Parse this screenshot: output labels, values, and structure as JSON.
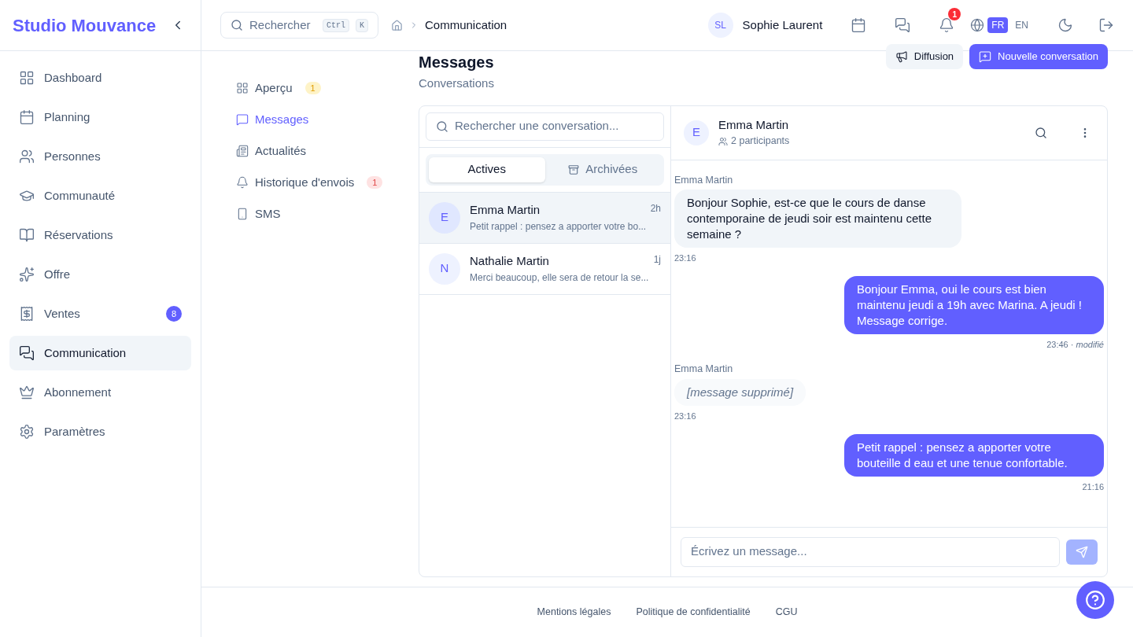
{
  "brand": "Studio Mouvance",
  "sidebar": {
    "items": [
      {
        "label": "Dashboard",
        "selected": false
      },
      {
        "label": "Planning",
        "selected": false
      },
      {
        "label": "Personnes",
        "selected": false
      },
      {
        "label": "Communauté",
        "selected": false
      },
      {
        "label": "Réservations",
        "selected": false
      },
      {
        "label": "Offre",
        "selected": false
      },
      {
        "label": "Ventes",
        "selected": false,
        "badge": "8"
      },
      {
        "label": "Communication",
        "selected": true
      },
      {
        "label": "Abonnement",
        "selected": false
      },
      {
        "label": "Paramètres",
        "selected": false
      }
    ]
  },
  "topbar": {
    "search": {
      "placeholder": "Rechercher",
      "keys": [
        "Ctrl",
        "K"
      ]
    },
    "breadcrumb": [
      "Communication"
    ],
    "user": {
      "initials": "SL",
      "name": "Sophie Laurent"
    },
    "notifications": "1",
    "languages": [
      {
        "label": "FR",
        "selected": true
      },
      {
        "label": "EN",
        "selected": false
      }
    ]
  },
  "subnav": [
    {
      "label": "Aperçu",
      "selected": false,
      "badge": {
        "text": "1",
        "color": "#fef3c7"
      }
    },
    {
      "label": "Messages",
      "selected": true
    },
    {
      "label": "Actualités",
      "selected": false
    },
    {
      "label": "Historique d'envois",
      "selected": false,
      "badge": {
        "text": "1",
        "color": "#fee2e2"
      }
    },
    {
      "label": "SMS",
      "selected": false
    }
  ],
  "page": {
    "title": "Messages",
    "subtitle": "Conversations",
    "actions": [
      {
        "label": "Diffusion",
        "kind": "secondary"
      },
      {
        "label": "Nouvelle conversation",
        "kind": "primary"
      }
    ]
  },
  "conversations": {
    "search": {
      "placeholder": "Rechercher une conversation..."
    },
    "tabs": [
      {
        "label": "Actives",
        "selected": true
      },
      {
        "label": "Archivées",
        "selected": false
      }
    ],
    "items": [
      {
        "initial": "E",
        "name": "Emma Martin",
        "time": "2h",
        "preview": "Petit rappel : pensez a apporter votre bo...",
        "selected": true
      },
      {
        "initial": "N",
        "name": "Nathalie Martin",
        "time": "1j",
        "preview": "Merci beaucoup, elle sera de retour la se...",
        "selected": false
      }
    ]
  },
  "chat": {
    "initial": "E",
    "name": "Emma Martin",
    "participants": "2 participants",
    "messages": [
      {
        "kind": "incoming",
        "sender": "Emma Martin",
        "text": "Bonjour Sophie, est-ce que le cours de danse contemporaine de jeudi soir est maintenu cette semaine ?",
        "time": "23:16"
      },
      {
        "kind": "outgoing",
        "text": "Bonjour Emma, oui le cours est bien maintenu jeudi a 19h avec Marina. A jeudi ! Message corrige.",
        "time": "23:46",
        "separator": "·",
        "edited": "modifié"
      },
      {
        "kind": "deleted",
        "sender": "Emma Martin",
        "text": "[message supprimé]",
        "time": "23:16"
      },
      {
        "kind": "outgoing",
        "text": "Petit rappel : pensez a apporter votre bouteille d eau et une tenue confortable.",
        "time": "21:16"
      }
    ],
    "composer": {
      "placeholder": "Écrivez un message..."
    }
  },
  "footer": {
    "links": [
      "Mentions légales",
      "Politique de confidentialité",
      "CGU"
    ]
  }
}
